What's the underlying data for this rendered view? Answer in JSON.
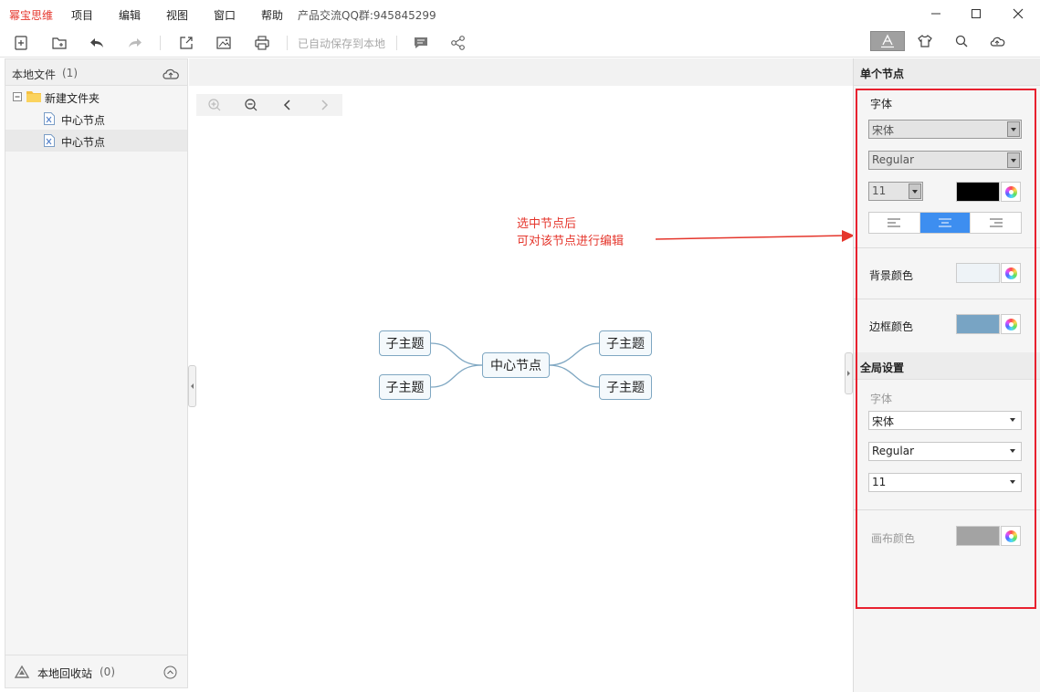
{
  "menubar": {
    "app_name": "幂宝思维",
    "menus": [
      "项目",
      "编辑",
      "视图",
      "窗口",
      "帮助"
    ],
    "qq_text": "产品交流QQ群:945845299"
  },
  "toolbar": {
    "autosave_text": "已自动保存到本地"
  },
  "sidebar": {
    "title": "本地文件",
    "count": "(1)",
    "folder": "新建文件夹",
    "files": [
      "中心节点",
      "中心节点"
    ],
    "recycle_label": "本地回收站",
    "recycle_count": "(0)"
  },
  "mindmap": {
    "center": "中心节点",
    "left_children": [
      "子主题",
      "子主题"
    ],
    "right_children": [
      "子主题",
      "子主题"
    ]
  },
  "annotation": {
    "line1": "选中节点后",
    "line2": "可对该节点进行编辑",
    "color": "#e5362c"
  },
  "panel": {
    "single_node_title": "单个节点",
    "font_label": "字体",
    "font_family": "宋体",
    "font_style": "Regular",
    "font_size": "11",
    "font_color": "#000000",
    "bg_color_label": "背景颜色",
    "bg_color": "#eef3f7",
    "border_color_label": "边框颜色",
    "border_color": "#78a4c4",
    "global_title": "全局设置",
    "global_font_label": "字体",
    "global_font_family": "宋体",
    "global_font_style": "Regular",
    "global_font_size": "11",
    "canvas_color_label": "画布颜色",
    "canvas_color": "#a3a3a3"
  }
}
